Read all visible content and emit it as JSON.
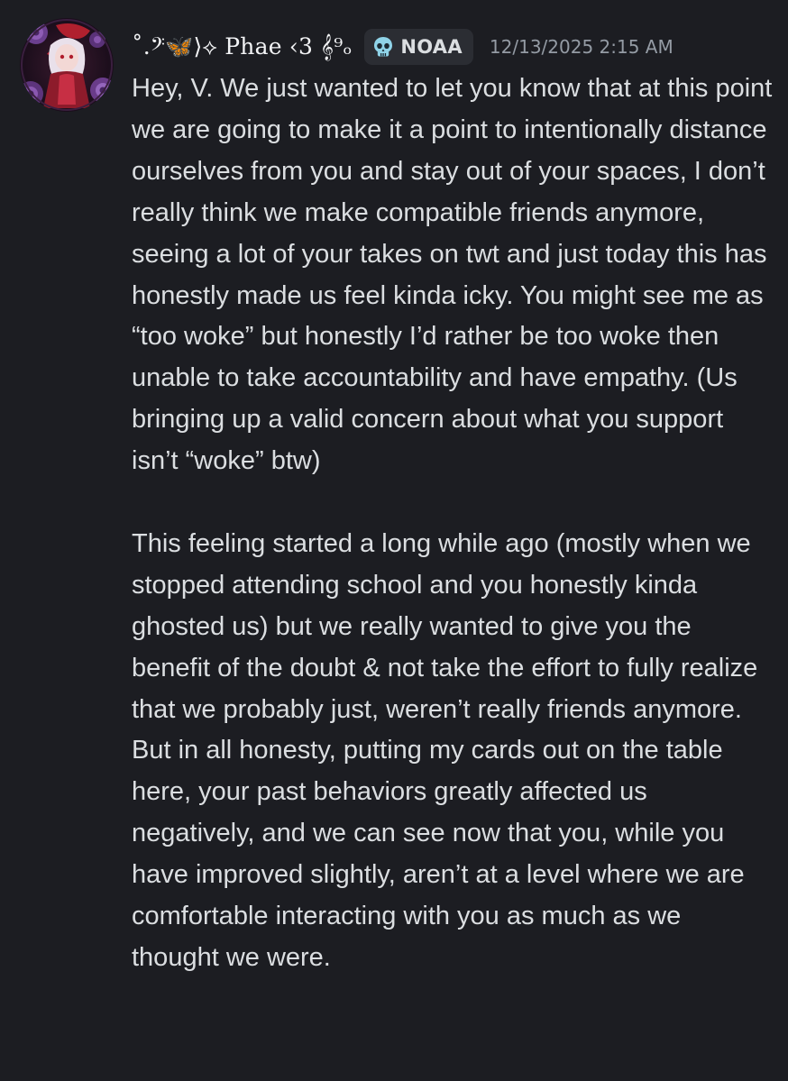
{
  "message": {
    "author": {
      "display_name": "˚.𝄢🦋⟩⟡ Phae ‹3 𝄞⁹ₒ",
      "avatar": "rose-character-avatar"
    },
    "server_tag": {
      "icon": "skull-icon",
      "label": "NOAA"
    },
    "timestamp": "12/13/2025 2:15 AM",
    "paragraphs": [
      "Hey, V. We just wanted to let you know that at this point we are going to make it a point to intentionally distance ourselves from you and stay out of your spaces, I don’t really think we make compatible friends anymore, seeing a lot of your takes on twt and just today this has honestly made us feel kinda icky. You might see me as “too woke” but honestly I’d rather be too woke then unable to take accountability and have empathy. (Us bringing up a valid concern about what you support isn’t “woke” btw)",
      "This feeling started a long while ago (mostly when we stopped attending school and you honestly kinda ghosted us) but we really wanted to give you the benefit of the doubt & not take the effort to fully realize that we probably just, weren’t really friends anymore. But in all honesty, putting my cards out on the table here, your past behaviors greatly affected us negatively, and we can see now that you, while you have improved slightly, aren’t at a level where we are comfortable interacting with you as much as we thought we were."
    ]
  },
  "colors": {
    "background": "#1c1d22",
    "text": "#dbdee1",
    "username": "#f2f3f5",
    "timestamp": "#949ba4",
    "tag_background": "#2b2d33"
  }
}
